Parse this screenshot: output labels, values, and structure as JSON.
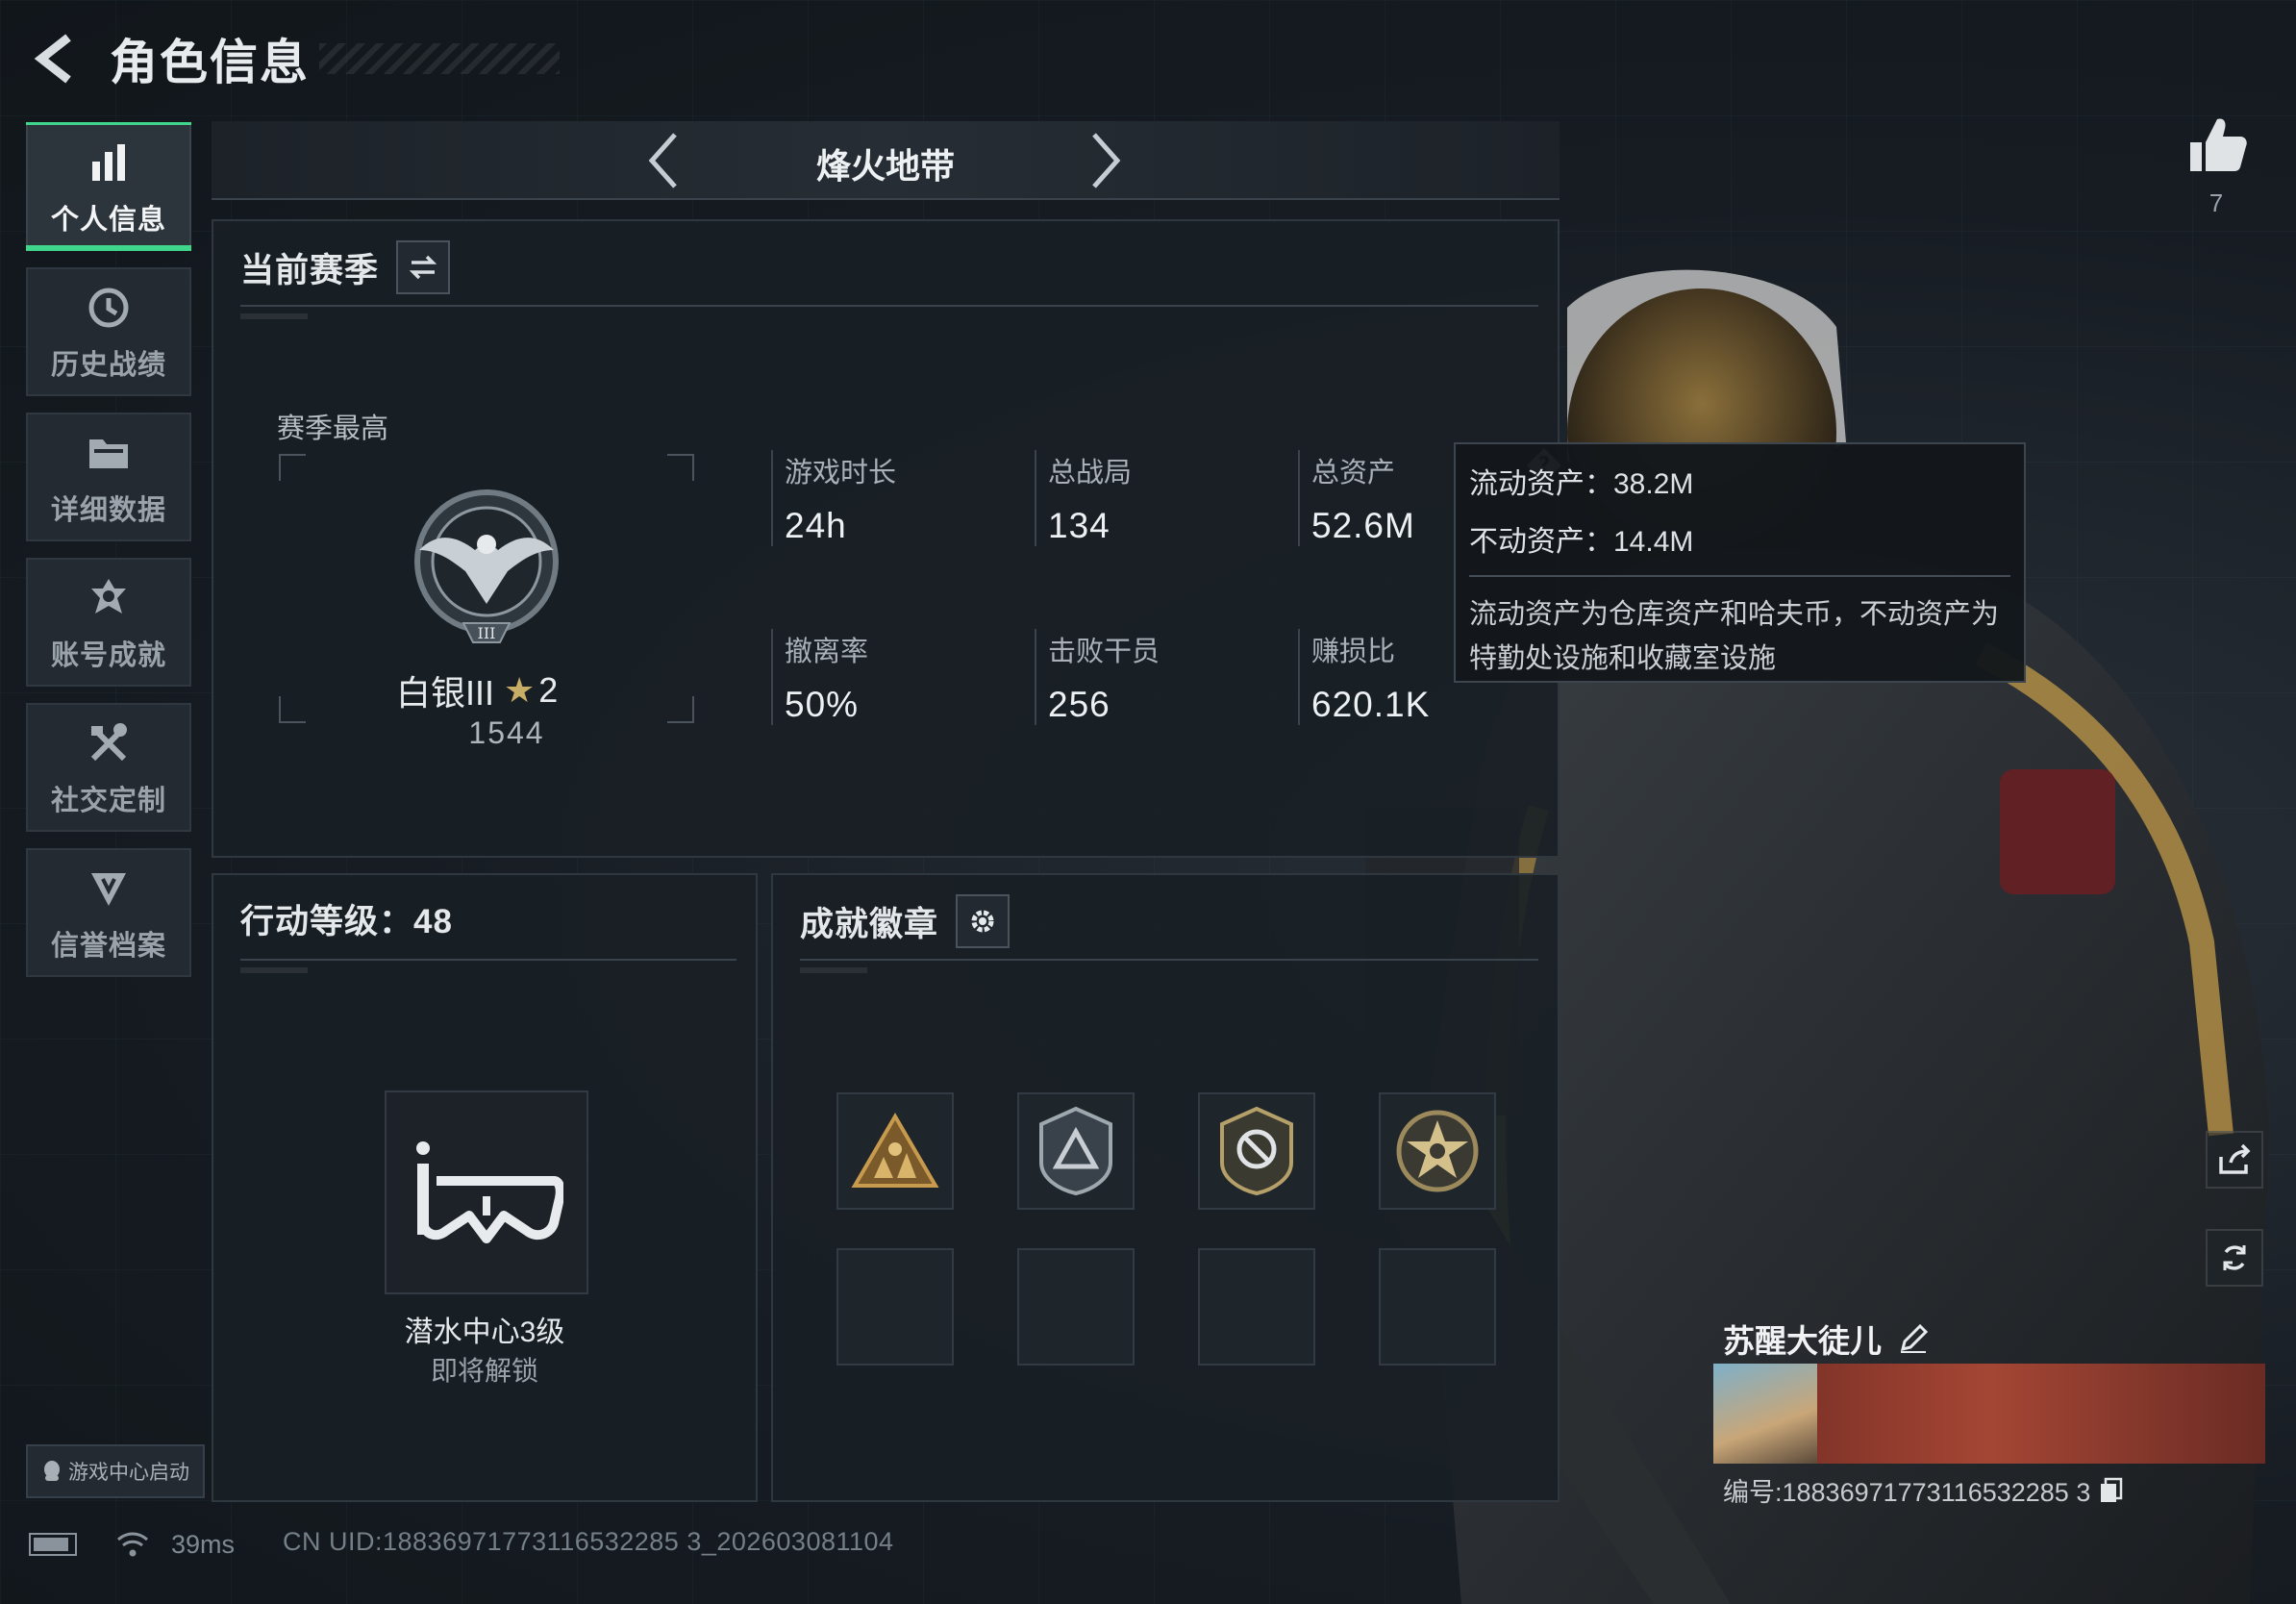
{
  "header": {
    "title": "角色信息"
  },
  "sidebar": {
    "items": [
      {
        "label": "个人信息",
        "icon": "bar-chart-icon",
        "active": true
      },
      {
        "label": "历史战绩",
        "icon": "history-icon",
        "active": false
      },
      {
        "label": "详细数据",
        "icon": "folder-icon",
        "active": false
      },
      {
        "label": "账号成就",
        "icon": "achievement-icon",
        "active": false
      },
      {
        "label": "社交定制",
        "icon": "tools-icon",
        "active": false
      },
      {
        "label": "信誉档案",
        "icon": "reputation-icon",
        "active": false
      }
    ],
    "launch_label": "游戏中心启动"
  },
  "mode_bar": {
    "title": "烽火地带"
  },
  "season": {
    "title": "当前赛季",
    "best_label": "赛季最高",
    "rank_name": "白银III",
    "rank_stars": "2",
    "rank_score": "1544",
    "stats": [
      {
        "label": "游戏时长",
        "value": "24h"
      },
      {
        "label": "总战局",
        "value": "134"
      },
      {
        "label": "总资产",
        "value": "52.6M"
      },
      {
        "label": "撤离率",
        "value": "50%"
      },
      {
        "label": "击败干员",
        "value": "256"
      },
      {
        "label": "赚损比",
        "value": "620.1K"
      }
    ]
  },
  "tooltip": {
    "liquid": "流动资产：38.2M",
    "fixed": "不动资产：14.4M",
    "desc": "流动资产为仓库资产和哈夫币，不动资产为特勤处设施和收藏室设施"
  },
  "level": {
    "title": "行动等级：48",
    "item_name": "潜水中心3级",
    "item_status": "即将解锁"
  },
  "badges": {
    "title": "成就徽章",
    "items": [
      "triangle-squad-badge",
      "shield-triangle-badge",
      "shield-crosshair-badge",
      "star-skull-badge"
    ]
  },
  "status": {
    "ping": "39ms",
    "uid": "CN UID:18836971773116532285 3_202603081104"
  },
  "profile": {
    "likes": "7",
    "name": "苏醒大徒儿",
    "id": "编号:18836971773116532285 3"
  },
  "colors": {
    "accent": "#3fd58a",
    "gold": "#c8ad67"
  }
}
